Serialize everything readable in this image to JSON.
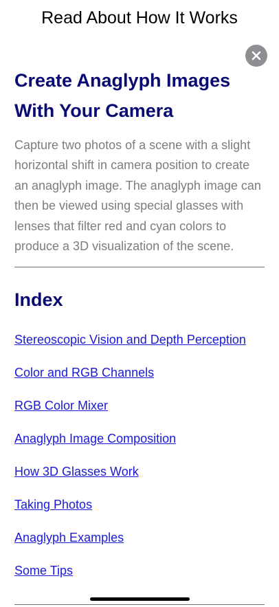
{
  "header": {
    "title": "Read About How It Works",
    "close_icon": "close-circle-icon"
  },
  "article": {
    "title": "Create Anaglyph Images With Your Camera",
    "intro": "Capture two photos of a scene with a slight horizontal shift in camera position to create an anaglyph image. The anaglyph image can then be viewed using special glasses with lenses that filter red and cyan colors to produce a 3D visualization of the scene."
  },
  "index": {
    "title": "Index",
    "links": [
      "Stereoscopic Vision and Depth Perception",
      "Color and RGB Channels",
      "RGB Color Mixer",
      "Anaglyph Image Composition",
      "How 3D Glasses Work",
      "Taking Photos",
      "Anaglyph Examples",
      "Some Tips"
    ]
  },
  "colors": {
    "heading": "#0a0a73",
    "link": "#1a1ad6",
    "body_text": "#7d7d7d",
    "close_button": "#8e8e93"
  }
}
